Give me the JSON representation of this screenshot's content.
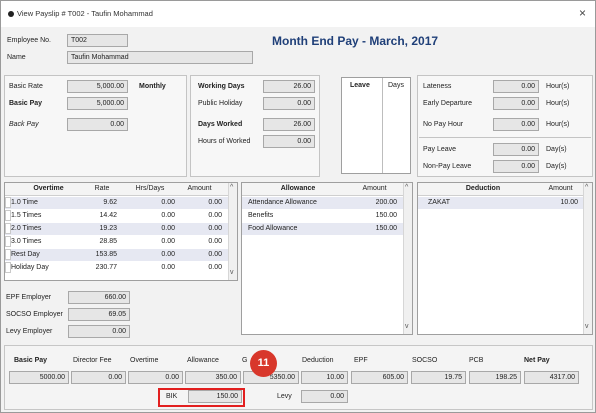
{
  "window": {
    "title": "View Payslip # T002 - Taufin Mohammad",
    "close_glyph": "×"
  },
  "heading": "Month End Pay - March, 2017",
  "employee": {
    "no_label": "Employee No.",
    "no_value": "T002",
    "name_label": "Name",
    "name_value": "Taufin Mohammad"
  },
  "pay": {
    "basic_rate_label": "Basic Rate",
    "basic_rate_value": "5,000.00",
    "monthly_label": "Monthly",
    "basic_pay_label": "Basic Pay",
    "basic_pay_value": "5,000.00",
    "back_pay_label": "Back Pay",
    "back_pay_value": "0.00"
  },
  "days": {
    "working_days_label": "Working Days",
    "working_days_value": "26.00",
    "public_holiday_label": "Public Holiday",
    "public_holiday_value": "0.00",
    "days_worked_label": "Days Worked",
    "days_worked_value": "26.00",
    "hours_worked_label": "Hours of Worked",
    "hours_worked_value": "0.00"
  },
  "leave": {
    "leave_header": "Leave",
    "days_header": "Days"
  },
  "attendance": {
    "lateness_label": "Lateness",
    "lateness_value": "0.00",
    "lateness_unit": "Hour(s)",
    "early_label": "Early Departure",
    "early_value": "0.00",
    "early_unit": "Hour(s)",
    "nopay_hour_label": "No Pay Hour",
    "nopay_hour_value": "0.00",
    "nopay_hour_unit": "Hour(s)",
    "pay_leave_label": "Pay Leave",
    "pay_leave_value": "0.00",
    "pay_leave_unit": "Day(s)",
    "nonpay_leave_label": "Non-Pay Leave",
    "nonpay_leave_value": "0.00",
    "nonpay_leave_unit": "Day(s)"
  },
  "overtime": {
    "headers": [
      "Overtime",
      "Rate",
      "Hrs/Days",
      "Amount"
    ],
    "rows": [
      [
        "1.0 Time",
        "9.62",
        "0.00",
        "0.00"
      ],
      [
        "1.5 Times",
        "14.42",
        "0.00",
        "0.00"
      ],
      [
        "2.0 Times",
        "19.23",
        "0.00",
        "0.00"
      ],
      [
        "3.0 Times",
        "28.85",
        "0.00",
        "0.00"
      ],
      [
        "Rest Day",
        "153.85",
        "0.00",
        "0.00"
      ],
      [
        "Holiday Day",
        "230.77",
        "0.00",
        "0.00"
      ]
    ]
  },
  "allowance": {
    "headers": [
      "Allowance",
      "Amount"
    ],
    "rows": [
      [
        "Attendance Allowance",
        "200.00"
      ],
      [
        "Benefits",
        "150.00"
      ],
      [
        "Food Allowance",
        "150.00"
      ]
    ]
  },
  "deduction": {
    "headers": [
      "Deduction",
      "Amount"
    ],
    "rows": [
      [
        "ZAKAT",
        "10.00"
      ]
    ]
  },
  "statutory": {
    "epf_label": "EPF Employer",
    "epf_value": "660.00",
    "socso_label": "SOCSO Employer",
    "socso_value": "69.05",
    "levy_label": "Levy Employer",
    "levy_value": "0.00"
  },
  "summary": {
    "headers": [
      "Basic Pay",
      "Director Fee",
      "Overtime",
      "Allowance",
      "G",
      "Deduction",
      "EPF",
      "SOCSO",
      "PCB",
      "Net Pay"
    ],
    "values": [
      "5000.00",
      "0.00",
      "0.00",
      "350.00",
      "5350.00",
      "10.00",
      "605.00",
      "19.75",
      "198.25",
      "4317.00"
    ],
    "bik_label": "BIK",
    "bik_value": "150.00",
    "levy_label": "Levy",
    "levy_value": "0.00"
  },
  "callout": {
    "number": "11",
    "color": "#d8372b"
  },
  "colors": {
    "heading": "#1f3f78",
    "highlight": "#e21f1f",
    "alt_row": "#e6e8f2"
  }
}
